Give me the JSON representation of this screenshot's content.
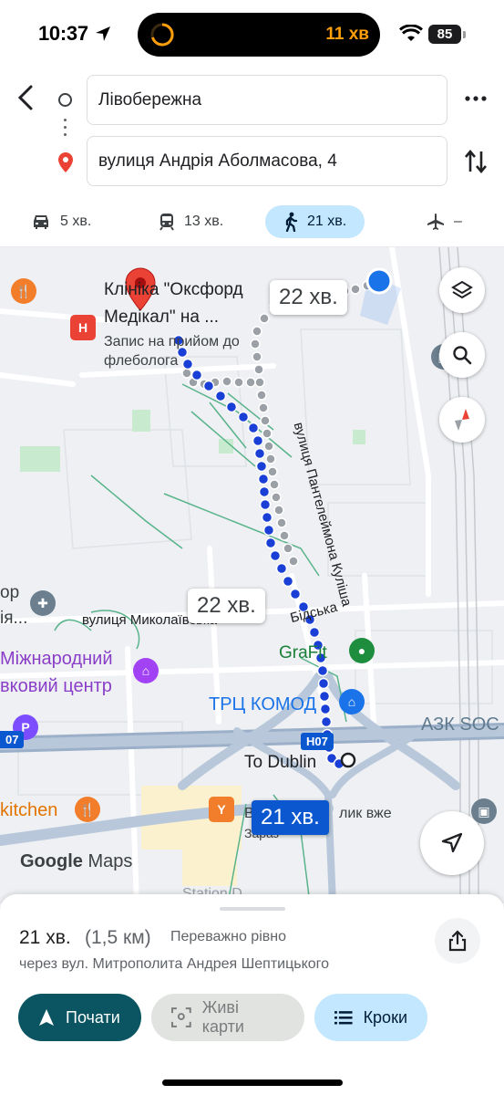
{
  "status_bar": {
    "time": "10:37",
    "timer": "11 хв",
    "battery": "85"
  },
  "directions": {
    "origin": "Лівобережна",
    "destination": "вулиця Андрія Аболмасова, 4"
  },
  "modes": [
    {
      "icon": "car-icon",
      "label": "5 хв."
    },
    {
      "icon": "train-icon",
      "label": "13 хв."
    },
    {
      "icon": "walk-icon",
      "label": "21 хв.",
      "active": true
    },
    {
      "icon": "plane-icon",
      "label": "–"
    }
  ],
  "map": {
    "labels": {
      "clinic_line1": "Клініка \"Оксфорд",
      "clinic_line2": "Медікал\" на ...",
      "clinic_sub1": "Запис на прийом до",
      "clinic_sub2": "флеболога",
      "street_pantelejmona": "вулиця Пантелеймона Куліша",
      "street_myklolaivska": "вулиця Миколаївська",
      "street_vidska": "Бідська",
      "intl_center_1": "Міжнародний",
      "intl_center_2": "вковий центр",
      "partial_or": "ор",
      "partial_ya": "ія...",
      "grafit": "GraFit",
      "trc_komod": "ТРЦ КОМОД",
      "azk": "АЗК SOC",
      "road_h07": "Н07",
      "road_h07_left": "07",
      "kitchen": "kitchen",
      "to_dublin": "To Dublin",
      "dublin_sub1": "В",
      "dublin_sub2": "лик вже",
      "dublin_sub3": "Зараз",
      "google_logo_google": "Google",
      "google_logo_maps": "Maps",
      "partial_bottom": "Station D..."
    },
    "bubbles": {
      "alt_top": "22 хв.",
      "alt_mid": "22 хв.",
      "selected": "21 хв."
    },
    "colors": {
      "route_primary": "#1a3fd6",
      "route_alt": "#9aa0a6",
      "user_location": "#1a73e8",
      "pin": "#ea4335"
    }
  },
  "sheet": {
    "duration": "21 хв.",
    "distance": "(1,5 км)",
    "note": "Переважно рівно",
    "via": "через вул. Митрополита Андрея Шептицького",
    "buttons": {
      "start": "Почати",
      "live": "Живі карти",
      "steps": "Кроки"
    }
  }
}
